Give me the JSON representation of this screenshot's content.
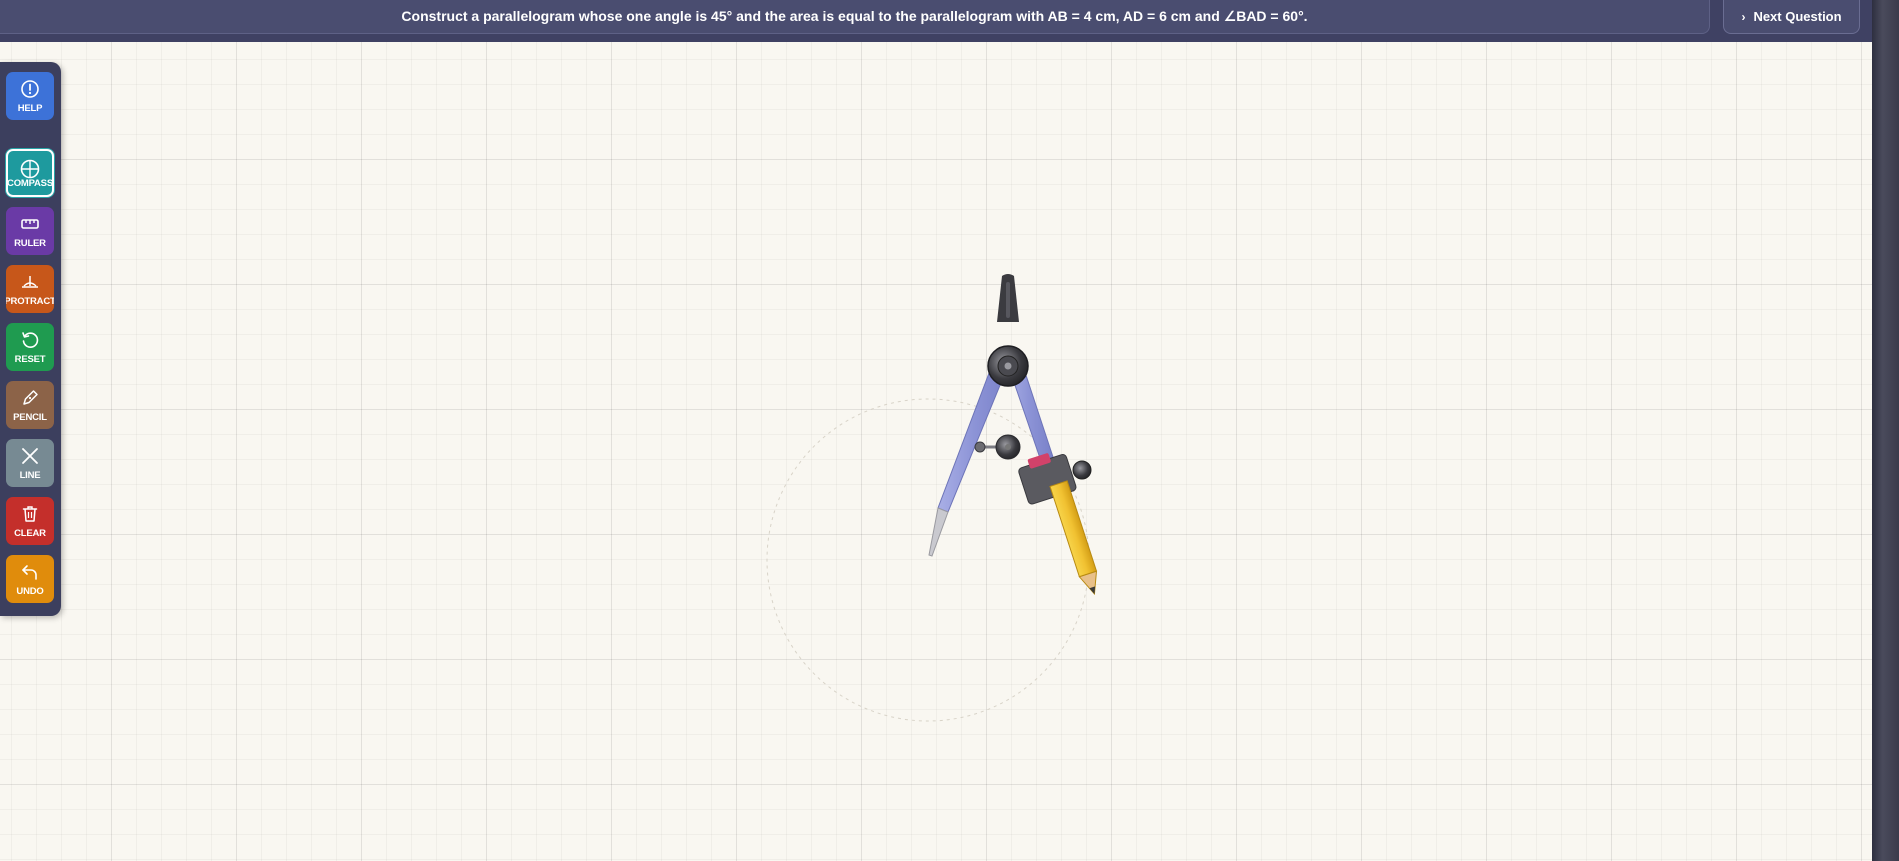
{
  "header": {
    "question": "Construct a parallelogram whose one angle is 45° and the area is equal to the parallelogram with AB = 4 cm, AD = 6 cm and ∠BAD = 60°.",
    "next_label": "Next Question"
  },
  "toolbar": {
    "tools": [
      {
        "label": "HELP",
        "icon": "help-icon",
        "color": "#3d72d8"
      },
      {
        "label": "COMPASS",
        "icon": "compass-icon",
        "color": "#1e9a9e",
        "active": true
      },
      {
        "label": "RULER",
        "icon": "ruler-icon",
        "color": "#6a3aa6"
      },
      {
        "label": "PROTRACT",
        "icon": "protractor-icon",
        "color": "#c7571a"
      },
      {
        "label": "RESET",
        "icon": "reset-icon",
        "color": "#1f9b50"
      },
      {
        "label": "PENCIL",
        "icon": "pencil-icon",
        "color": "#8c6348"
      },
      {
        "label": "LINE",
        "icon": "line-icon",
        "color": "#778a93"
      },
      {
        "label": "CLEAR",
        "icon": "trash-icon",
        "color": "#c42f2b"
      },
      {
        "label": "UNDO",
        "icon": "undo-icon",
        "color": "#e08c0c"
      }
    ]
  },
  "colors": {
    "header_bg": "#3f4163",
    "canvas_bg": "#f9f7f1",
    "compass_leg": "#8f97d8",
    "pencil": "#f1c232"
  }
}
